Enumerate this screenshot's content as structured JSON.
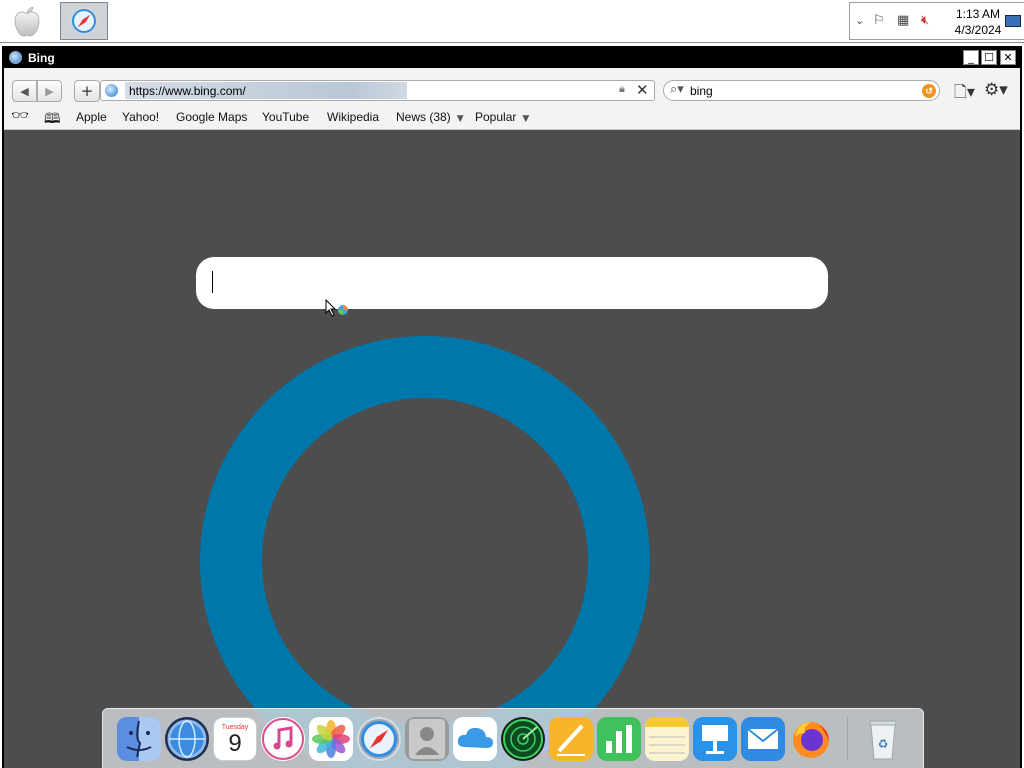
{
  "taskbar": {
    "clock_time": "1:13 AM",
    "clock_date": "4/3/2024"
  },
  "window": {
    "title": "Bing"
  },
  "toolbar": {
    "url": "https://www.bing.com/",
    "search_query": "bing",
    "bookmarks": [
      {
        "label": "Apple"
      },
      {
        "label": "Yahoo!"
      },
      {
        "label": "Google Maps"
      },
      {
        "label": "YouTube"
      },
      {
        "label": "Wikipedia"
      },
      {
        "label": "News (38)"
      },
      {
        "label": "Popular"
      }
    ]
  },
  "dock": {
    "calendar_day": "9",
    "calendar_weekday": "Tuesday"
  },
  "colors": {
    "page_background": "#4d4d4d",
    "bing_accent": "#0077aa"
  }
}
